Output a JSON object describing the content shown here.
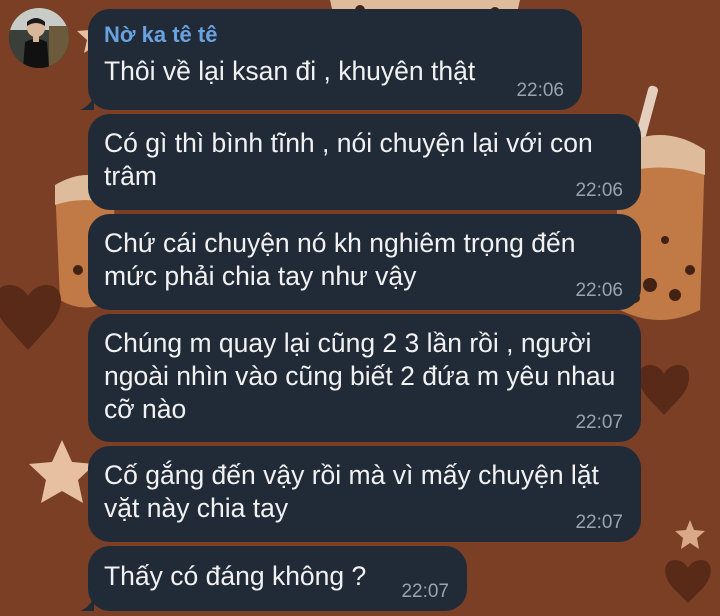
{
  "chat": {
    "sender_name": "Nờ ka tê tê",
    "messages": [
      {
        "lines": [
          "Thôi về lại ksan đi , khuyên thật"
        ],
        "time": "22:06"
      },
      {
        "lines": [
          "Có gì thì bình tĩnh , nói chuyện lại với con",
          "trâm"
        ],
        "time": "22:06"
      },
      {
        "lines": [
          "Chứ cái chuyện nó kh nghiêm trọng đến",
          "mức phải chia tay như vậy"
        ],
        "time": "22:06"
      },
      {
        "lines": [
          "Chúng m quay lại cũng 2 3 lần rồi , người",
          "ngoài nhìn vào cũng biết 2 đứa m yêu nhau",
          "cỡ nào"
        ],
        "time": "22:07"
      },
      {
        "lines": [
          "Cố gắng đến vậy rồi mà vì mấy chuyện lặt",
          "vặt này chia tay"
        ],
        "time": "22:07"
      },
      {
        "lines": [
          "Thấy có đáng không ?"
        ],
        "time": "22:07"
      }
    ]
  },
  "colors": {
    "wallpaper": "#7b3f26",
    "bubble": "#212b38",
    "sender_name": "#6aa2e0",
    "timestamp": "#98a3ae",
    "message_text": "#f1f1f1"
  },
  "icons": {
    "avatar": "user-avatar-photo"
  }
}
